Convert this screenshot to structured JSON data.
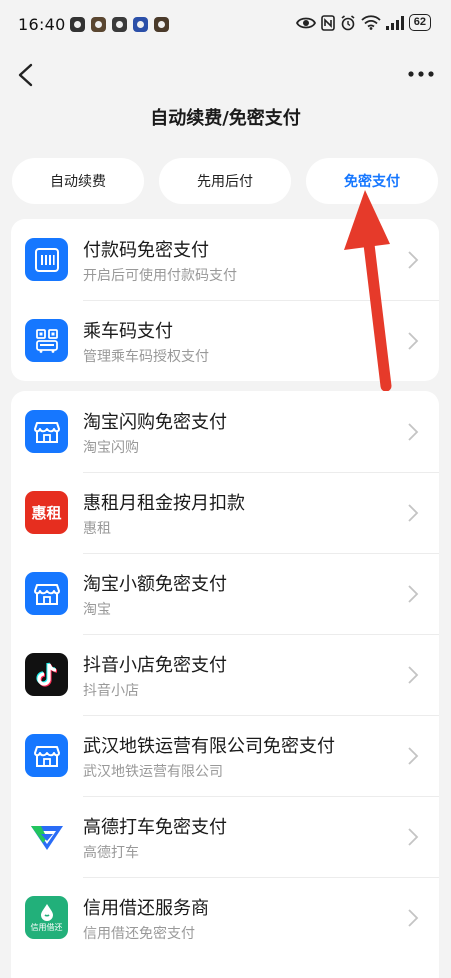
{
  "status_bar": {
    "time": "16:40",
    "battery": "62",
    "icons": [
      "eye-icon",
      "nfc-icon",
      "alarm-icon",
      "wifi-icon",
      "signal-icon",
      "battery-icon"
    ]
  },
  "header": {
    "title": "自动续费/免密支付",
    "back_icon": "chevron-left-icon",
    "more_icon": "more-dots-icon"
  },
  "tabs": [
    {
      "label": "自动续费",
      "active": false
    },
    {
      "label": "先用后付",
      "active": false
    },
    {
      "label": "免密支付",
      "active": true
    }
  ],
  "accent_color": "#1677ff",
  "annotation_color": "#e63a2a",
  "card1": {
    "items": [
      {
        "title": "付款码免密支付",
        "subtitle": "开启后可使用付款码支付",
        "icon": "payment-code-icon"
      },
      {
        "title": "乘车码支付",
        "subtitle": "管理乘车码授权支付",
        "icon": "transit-code-icon"
      }
    ]
  },
  "card2": {
    "items": [
      {
        "title": "淘宝闪购免密支付",
        "subtitle": "淘宝闪购",
        "icon": "store-icon"
      },
      {
        "title": "惠租月租金按月扣款",
        "subtitle": "惠租",
        "icon": "huizu-logo",
        "logo_text": "惠租"
      },
      {
        "title": "淘宝小额免密支付",
        "subtitle": "淘宝",
        "icon": "store-icon"
      },
      {
        "title": "抖音小店免密支付",
        "subtitle": "抖音小店",
        "icon": "douyin-logo"
      },
      {
        "title": "武汉地铁运营有限公司免密支付",
        "subtitle": "武汉地铁运营有限公司",
        "icon": "store-icon"
      },
      {
        "title": "高德打车免密支付",
        "subtitle": "高德打车",
        "icon": "amap-logo"
      },
      {
        "title": "信用借还服务商",
        "subtitle": "信用借还免密支付",
        "icon": "credit-borrow-logo",
        "logo_text": "信用借还"
      }
    ]
  }
}
